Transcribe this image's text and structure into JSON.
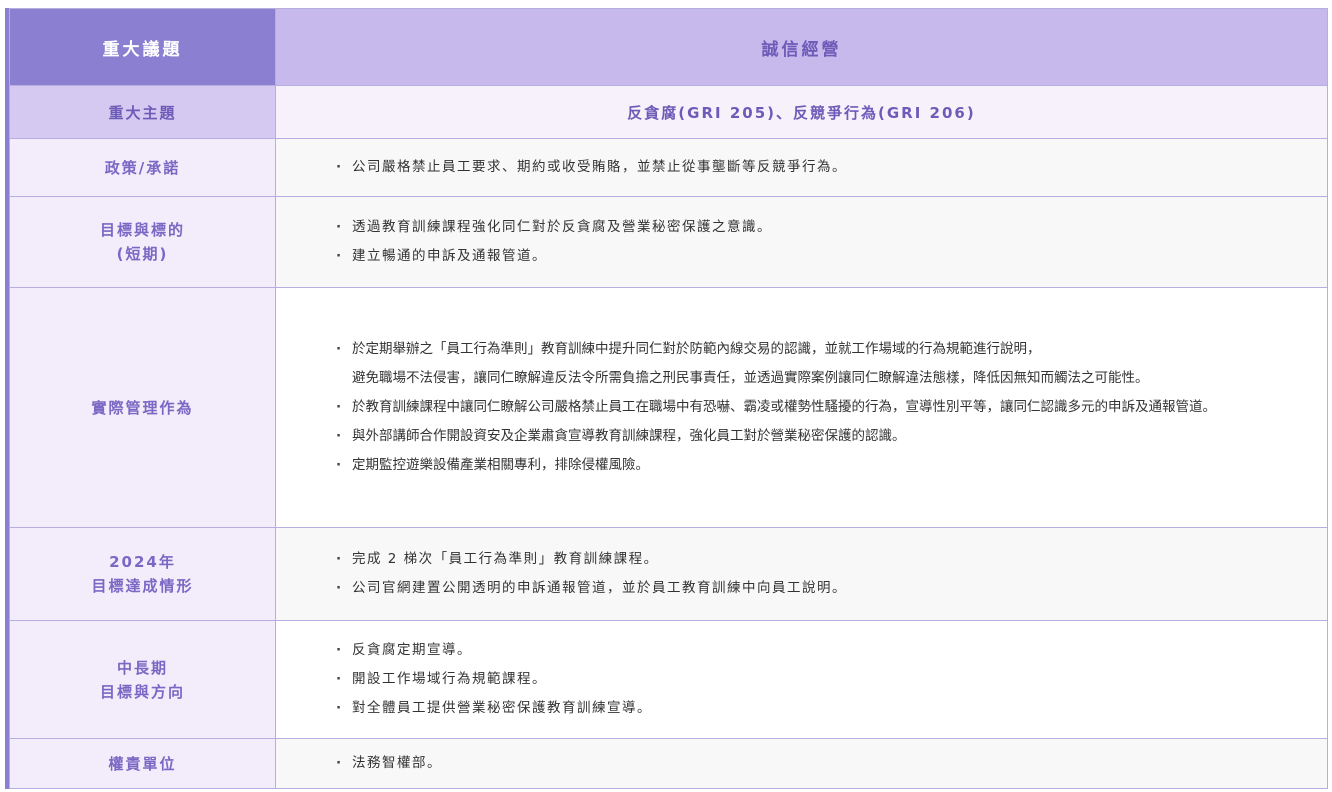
{
  "header": {
    "left": "重大議題",
    "right": "誠信經營"
  },
  "subheader": {
    "left": "重大主題",
    "right": "反貪腐(GRI 205)、反競爭行為(GRI 206)"
  },
  "rows": [
    {
      "label_lines": [
        "政策/承諾"
      ],
      "items": [
        "公司嚴格禁止員工要求、期約或收受賄賂，並禁止從事壟斷等反競爭行為。"
      ]
    },
    {
      "label_lines": [
        "目標與標的",
        "(短期)"
      ],
      "items": [
        "透過教育訓練課程強化同仁對於反貪腐及營業秘密保護之意識。",
        "建立暢通的申訴及通報管道。"
      ]
    },
    {
      "label_lines": [
        "實際管理作為"
      ],
      "items": [
        "於定期舉辦之「員工行為準則」教育訓練中提升同仁對於防範內線交易的認識，並就工作場域的行為規範進行說明，",
        "避免職場不法侵害，讓同仁瞭解違反法令所需負擔之刑民事責任，並透過實際案例讓同仁瞭解違法態樣，降低因無知而觸法之可能性。",
        "於教育訓練課程中讓同仁瞭解公司嚴格禁止員工在職場中有恐嚇、霸凌或權勢性騷擾的行為，宣導性別平等，讓同仁認識多元的申訴及通報管道。",
        "與外部講師合作開設資安及企業肅貪宣導教育訓練課程，強化員工對於營業秘密保護的認識。",
        "定期監控遊樂設備產業相關專利，排除侵權風險。"
      ]
    },
    {
      "label_lines": [
        "2024年",
        "目標達成情形"
      ],
      "items": [
        "完成 2 梯次「員工行為準則」教育訓練課程。",
        "公司官網建置公開透明的申訴通報管道，並於員工教育訓練中向員工說明。"
      ]
    },
    {
      "label_lines": [
        "中長期",
        "目標與方向"
      ],
      "items": [
        "反貪腐定期宣導。",
        "開設工作場域行為規範課程。",
        "對全體員工提供營業秘密保護教育訓練宣導。"
      ]
    },
    {
      "label_lines": [
        "權責單位"
      ],
      "items": [
        "法務智權部。"
      ]
    }
  ]
}
